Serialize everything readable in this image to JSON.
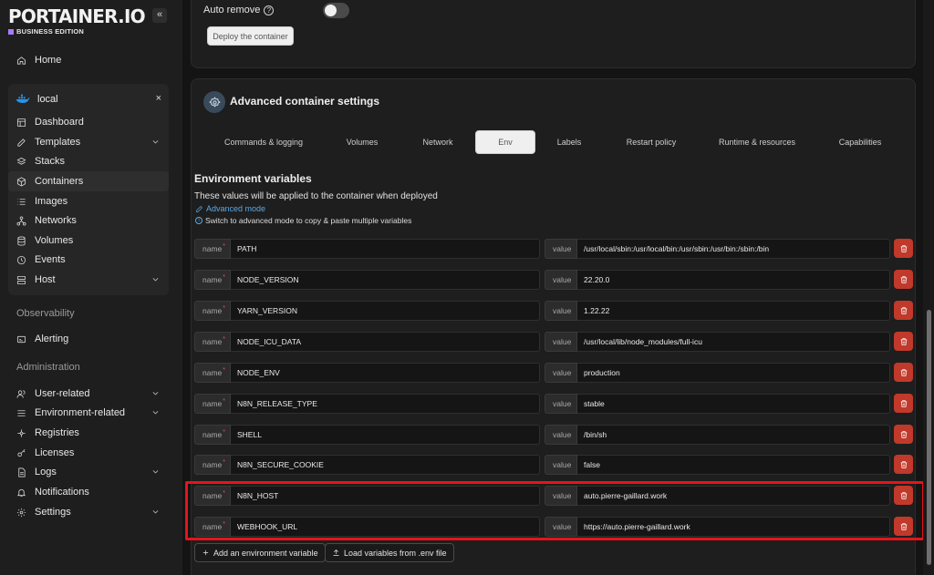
{
  "brand": {
    "name": "PORTAINER.IO",
    "edition": "BUSINESS EDITION",
    "collapse_icon": "«"
  },
  "sidebar": {
    "home": "Home",
    "environment": {
      "name": "local",
      "close": "×"
    },
    "env_items": [
      {
        "label": "Dashboard",
        "icon": "dashboard-icon"
      },
      {
        "label": "Templates",
        "icon": "edit-icon"
      },
      {
        "label": "Stacks",
        "icon": "layers-icon"
      },
      {
        "label": "Containers",
        "icon": "box-icon"
      },
      {
        "label": "Images",
        "icon": "list-icon"
      },
      {
        "label": "Networks",
        "icon": "network-icon"
      },
      {
        "label": "Volumes",
        "icon": "database-icon"
      },
      {
        "label": "Events",
        "icon": "clock-icon"
      },
      {
        "label": "Host",
        "icon": "server-icon"
      }
    ],
    "observability_label": "Observability",
    "alerting": "Alerting",
    "administration_label": "Administration",
    "admin_items": [
      {
        "label": "User-related"
      },
      {
        "label": "Environment-related"
      },
      {
        "label": "Registries"
      },
      {
        "label": "Licenses"
      },
      {
        "label": "Logs"
      },
      {
        "label": "Notifications"
      },
      {
        "label": "Settings"
      }
    ]
  },
  "deploy": {
    "auto_remove_label": "Auto remove",
    "auto_remove_help": "?",
    "auto_remove_enabled": false,
    "deploy_button": "Deploy the container"
  },
  "advanced": {
    "title": "Advanced container settings",
    "tabs": [
      "Commands & logging",
      "Volumes",
      "Network",
      "Env",
      "Labels",
      "Restart policy",
      "Runtime & resources",
      "Capabilities"
    ],
    "active_tab": "Env"
  },
  "env": {
    "title": "Environment variables",
    "description": "These values will be applied to the container when deployed",
    "advanced_mode_link": "Advanced mode",
    "hint": "Switch to advanced mode to copy & paste multiple variables",
    "hint_icon": "i",
    "name_addon": "name",
    "required_marker": "*",
    "value_addon": "value",
    "variables": [
      {
        "name": "PATH",
        "value": "/usr/local/sbin:/usr/local/bin:/usr/sbin:/usr/bin:/sbin:/bin"
      },
      {
        "name": "NODE_VERSION",
        "value": "22.20.0"
      },
      {
        "name": "YARN_VERSION",
        "value": "1.22.22"
      },
      {
        "name": "NODE_ICU_DATA",
        "value": "/usr/local/lib/node_modules/full-icu"
      },
      {
        "name": "NODE_ENV",
        "value": "production"
      },
      {
        "name": "N8N_RELEASE_TYPE",
        "value": "stable"
      },
      {
        "name": "SHELL",
        "value": "/bin/sh"
      },
      {
        "name": "N8N_SECURE_COOKIE",
        "value": "false"
      },
      {
        "name": "N8N_HOST",
        "value": "auto.pierre-gaillard.work"
      },
      {
        "name": "WEBHOOK_URL",
        "value": "https://auto.pierre-gaillard.work"
      }
    ],
    "add_button": "Add an environment variable",
    "load_button": "Load variables from .env file"
  },
  "colors": {
    "highlight": "#e5141b",
    "delete": "#c0392b",
    "link": "#5aa9e6",
    "edition_accent": "#a77bff"
  }
}
